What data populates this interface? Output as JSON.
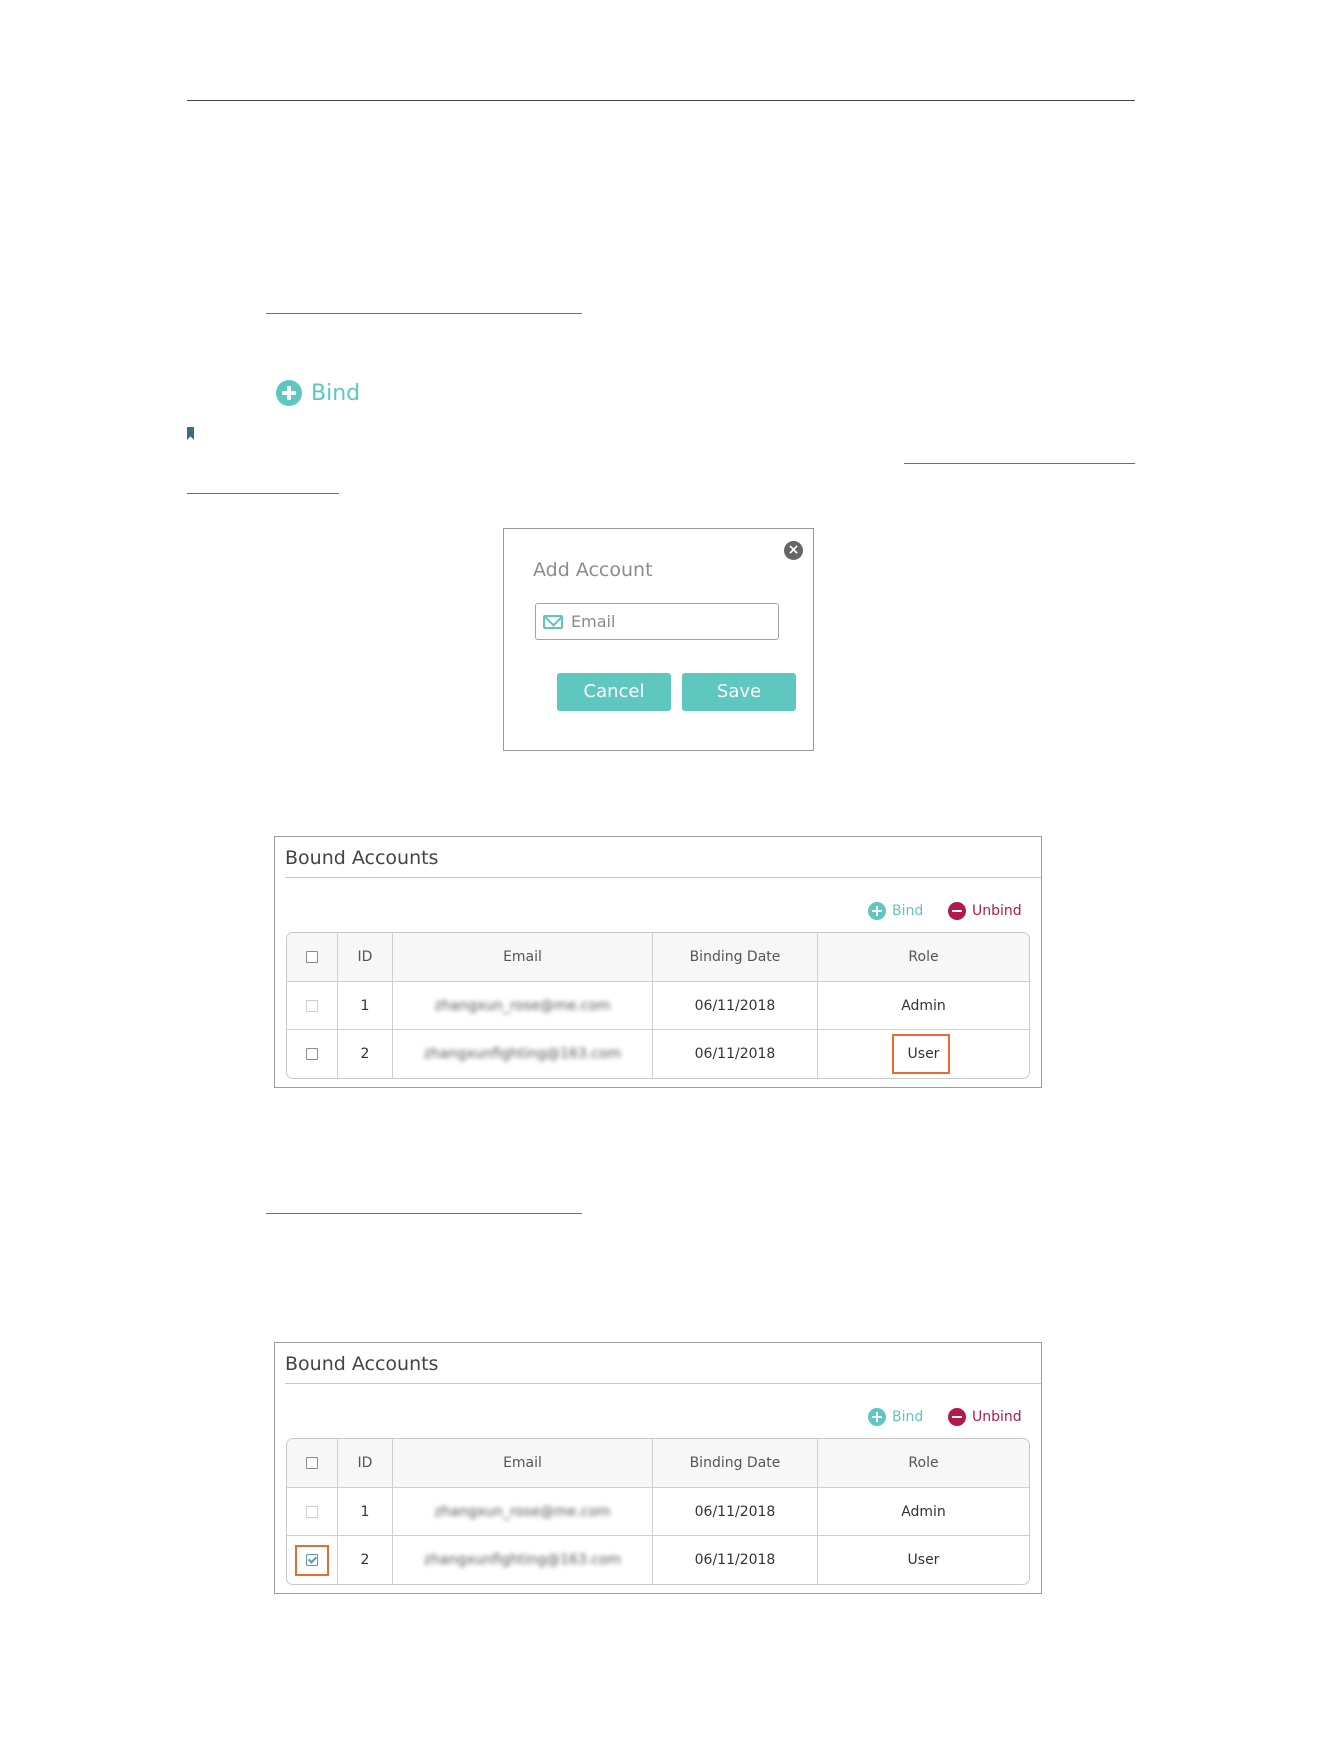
{
  "big_bind": {
    "label": "Bind"
  },
  "dialog": {
    "title": "Add Account",
    "close_glyph": "×",
    "email_placeholder": "Email",
    "cancel_label": "Cancel",
    "save_label": "Save"
  },
  "panels": [
    {
      "title": "Bound Accounts",
      "bind_label": "Bind",
      "unbind_label": "Unbind",
      "headers": [
        "ID",
        "Email",
        "Binding Date",
        "Role"
      ],
      "rows": [
        {
          "id": "1",
          "email": "zhangxun_rose@me.com",
          "date": "06/11/2018",
          "role": "Admin",
          "checked": false,
          "disabled": true
        },
        {
          "id": "2",
          "email": "zhangxunfighting@163.com",
          "date": "06/11/2018",
          "role": "User",
          "checked": false,
          "disabled": false
        }
      ]
    },
    {
      "title": "Bound Accounts",
      "bind_label": "Bind",
      "unbind_label": "Unbind",
      "headers": [
        "ID",
        "Email",
        "Binding Date",
        "Role"
      ],
      "rows": [
        {
          "id": "1",
          "email": "zhangxun_rose@me.com",
          "date": "06/11/2018",
          "role": "Admin",
          "checked": false,
          "disabled": true
        },
        {
          "id": "2",
          "email": "zhangxunfighting@163.com",
          "date": "06/11/2018",
          "role": "User",
          "checked": true,
          "disabled": false
        }
      ]
    }
  ],
  "colors": {
    "accent": "#5ec7c0",
    "unbind": "#b3184a",
    "highlight": "#e86c2e"
  }
}
